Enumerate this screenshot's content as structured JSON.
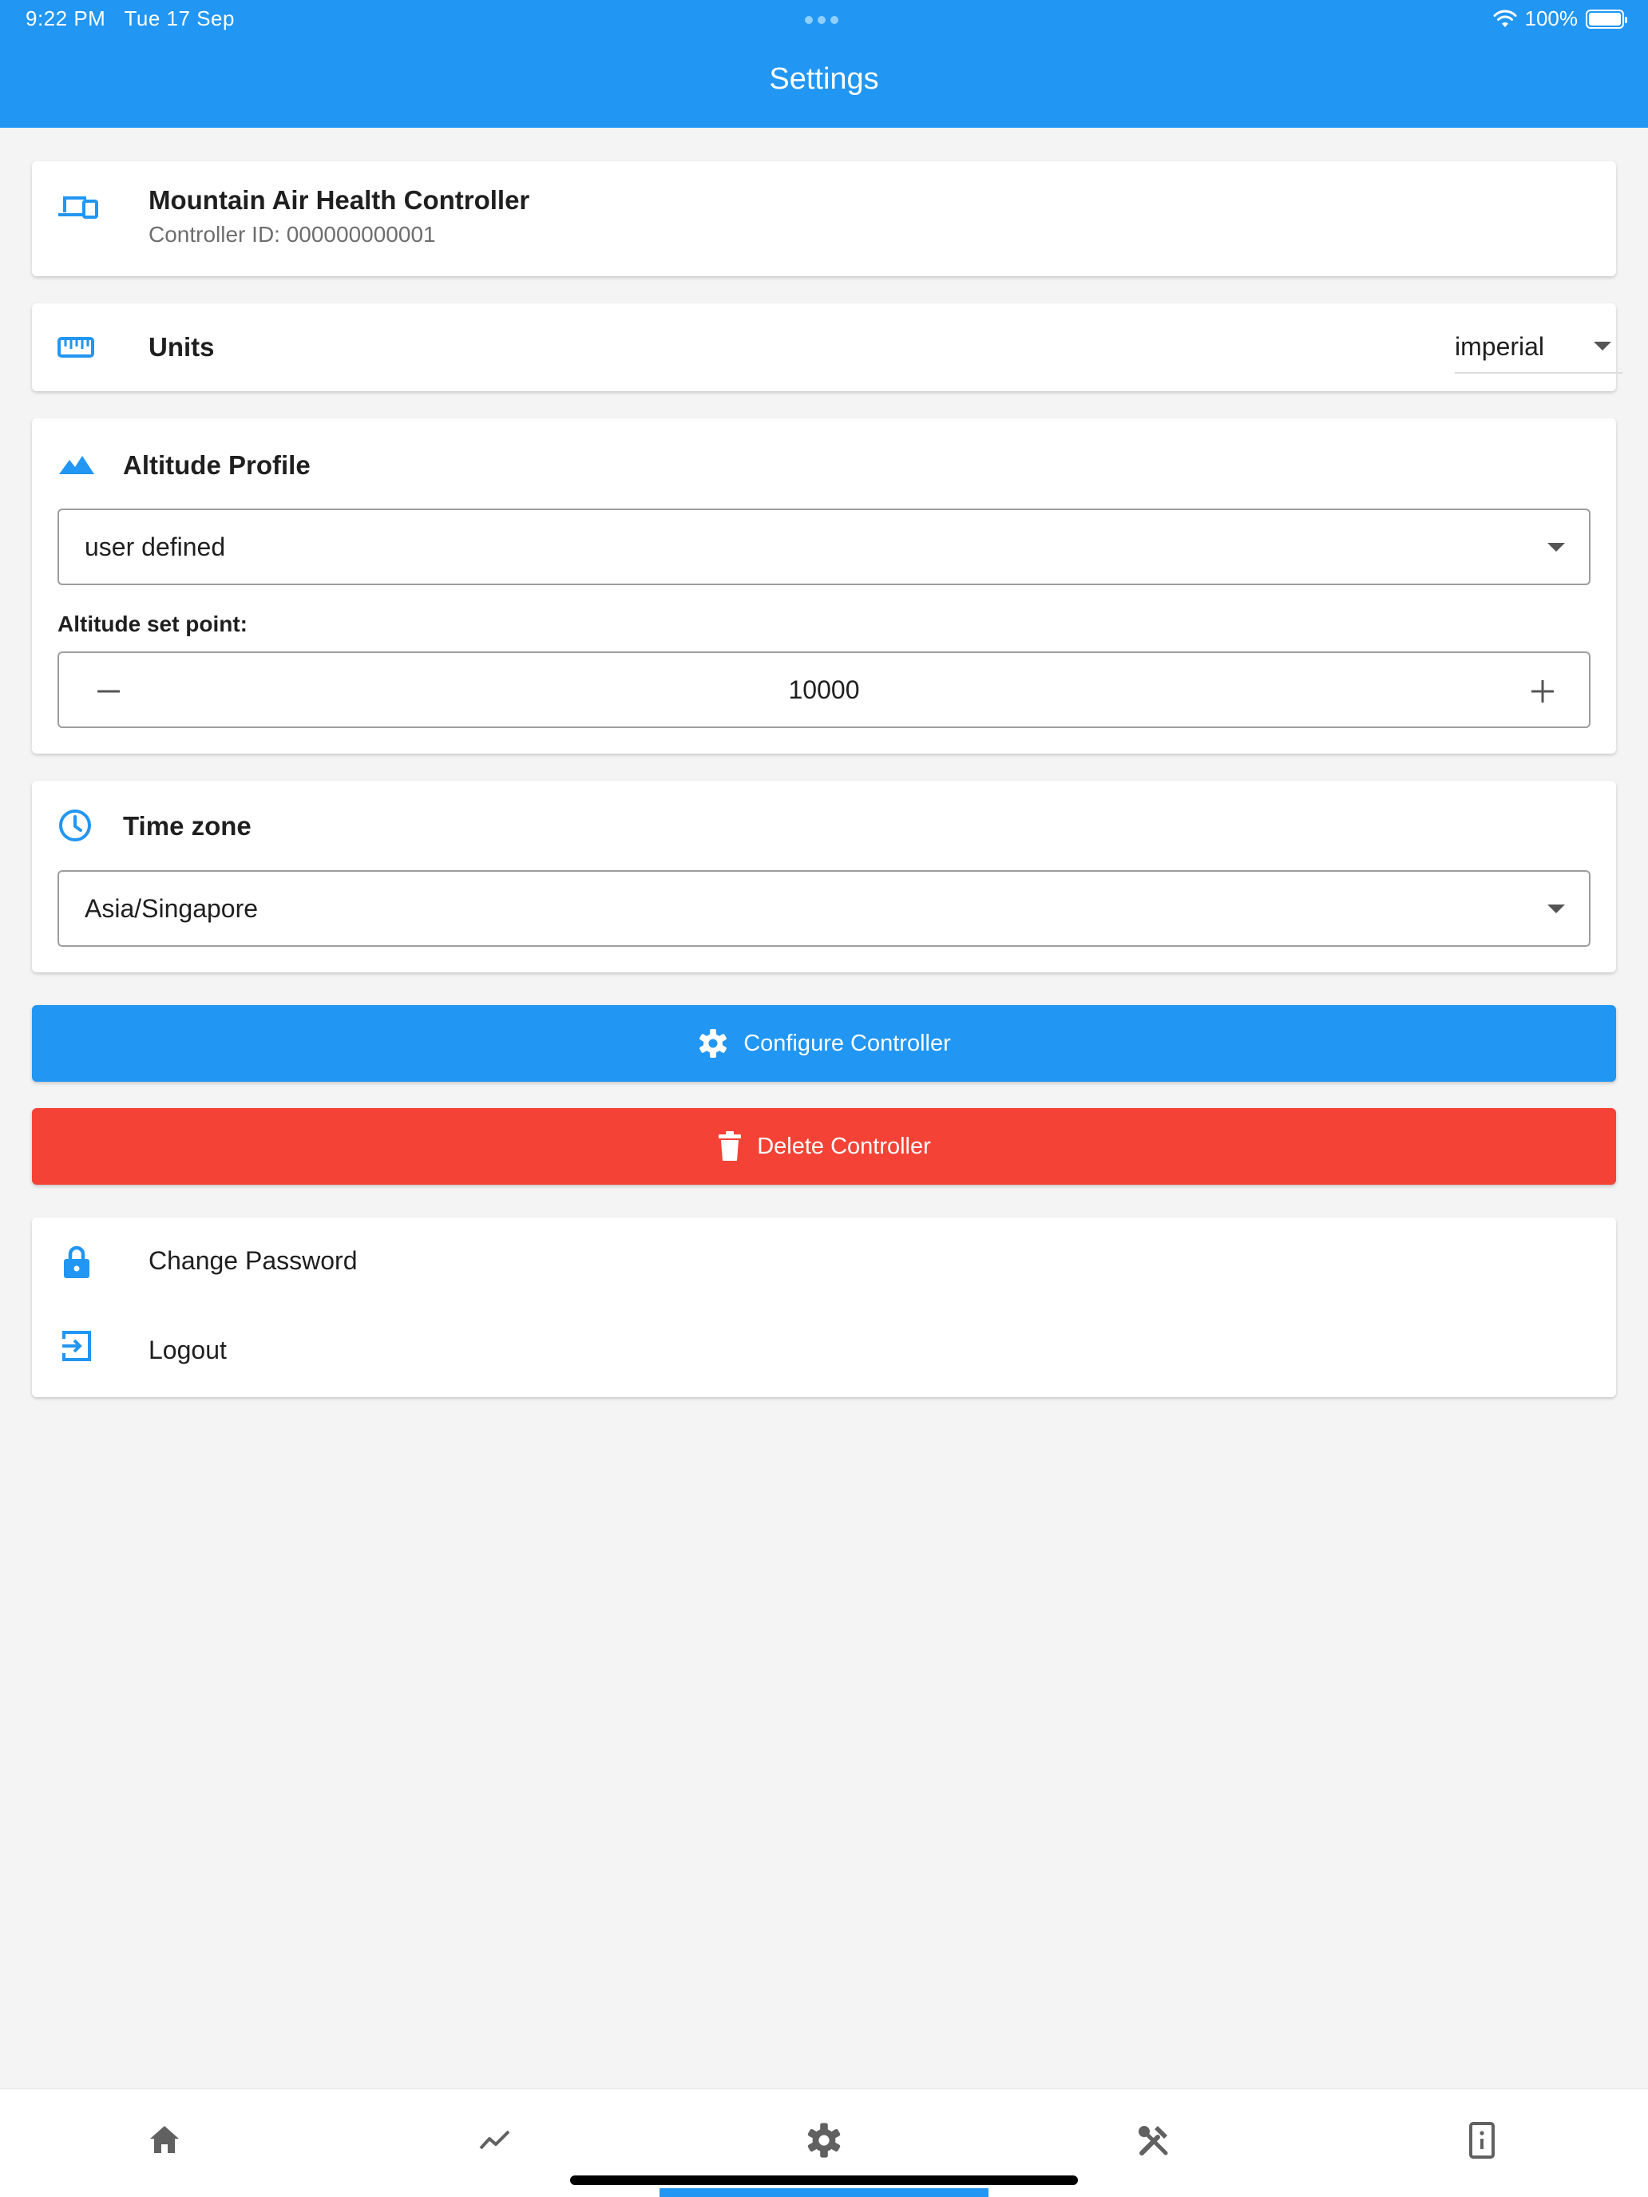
{
  "status_bar": {
    "time": "9:22 PM",
    "date": "Tue 17 Sep",
    "battery": "100%"
  },
  "header": {
    "title": "Settings"
  },
  "controller": {
    "name": "Mountain Air Health Controller",
    "id_line": "Controller ID: 000000000001",
    "icon": "devices-icon"
  },
  "units": {
    "label": "Units",
    "value": "imperial",
    "icon": "ruler-icon"
  },
  "altitude": {
    "title": "Altitude Profile",
    "profile_value": "user defined",
    "setpoint_label": "Altitude set point:",
    "setpoint_value": "10000",
    "icon": "mountain-icon"
  },
  "timezone": {
    "title": "Time zone",
    "value": "Asia/Singapore",
    "icon": "clock-icon"
  },
  "actions": {
    "configure_label": "Configure Controller",
    "delete_label": "Delete Controller"
  },
  "account": {
    "change_password_label": "Change Password",
    "logout_label": "Logout"
  },
  "bottom_nav": {
    "items": [
      "home-icon",
      "chart-icon",
      "settings-icon",
      "tools-icon",
      "info-icon"
    ],
    "active": "settings-icon"
  },
  "colors": {
    "primary": "#2196f3",
    "danger": "#f44336",
    "background": "#f4f4f4",
    "inactive_icon": "#616161"
  }
}
